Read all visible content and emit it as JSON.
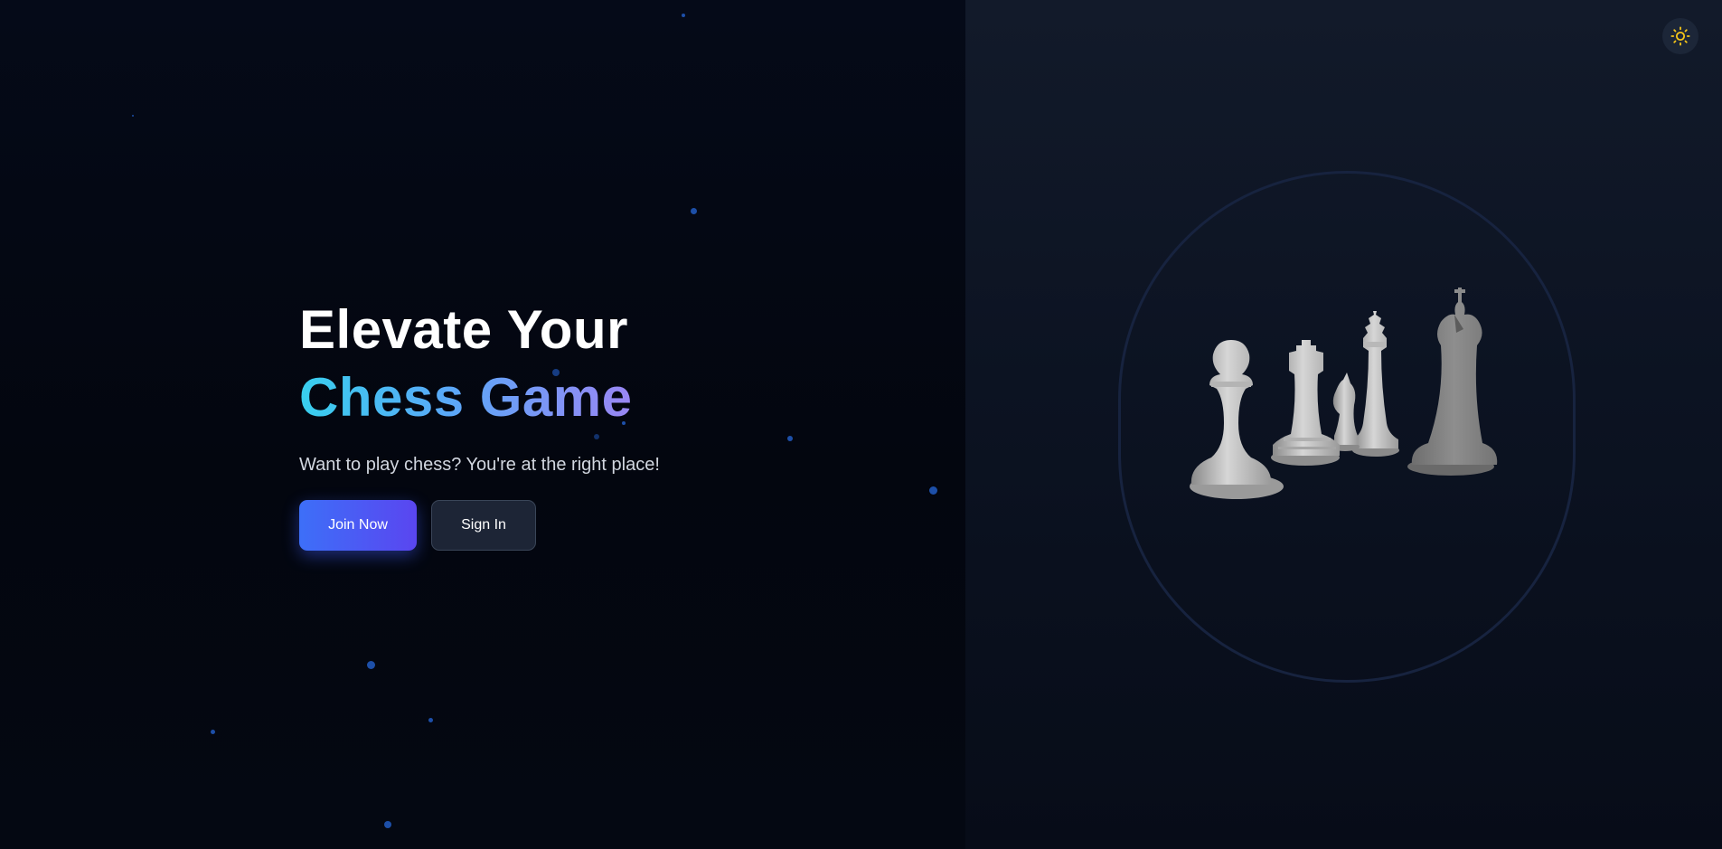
{
  "hero": {
    "headline_line1": "Elevate Your",
    "headline_line2": "Chess Game",
    "tagline": "Want to play chess? You're at the right place!"
  },
  "actions": {
    "join_label": "Join Now",
    "signin_label": "Sign In"
  },
  "theme_toggle": {
    "icon": "sun-icon",
    "icon_color": "#f5c518"
  },
  "hero_image": {
    "pieces": [
      "pawn",
      "rook",
      "knight",
      "queen",
      "king"
    ]
  },
  "colors": {
    "background": "#03060f",
    "panel": "#0c1322",
    "headline_gradient": [
      "#38cfee",
      "#9a86f4"
    ],
    "primary_button": [
      "#3d6ff8",
      "#5a46f0"
    ],
    "secondary_button": "#1d2536",
    "particle": "#1d4fa8"
  }
}
